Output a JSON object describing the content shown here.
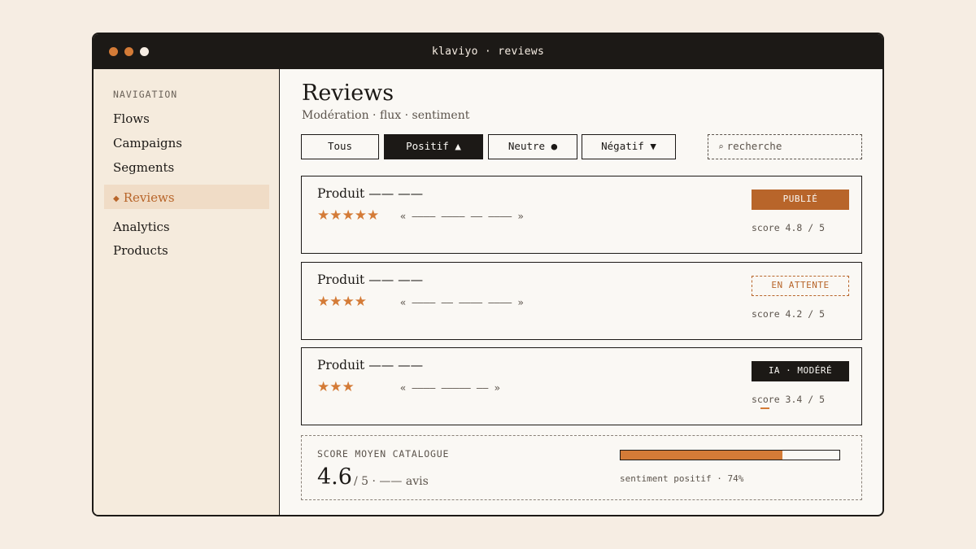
{
  "window": {
    "title": "klaviyo · reviews"
  },
  "sidebar": {
    "heading": "NAVIGATION",
    "items": [
      {
        "label": "Flows",
        "active": false
      },
      {
        "label": "Campaigns",
        "active": false
      },
      {
        "label": "Segments",
        "active": false
      },
      {
        "label": "Reviews",
        "active": true,
        "marker": "◆"
      },
      {
        "label": "Analytics",
        "active": false
      },
      {
        "label": "Products",
        "active": false
      }
    ]
  },
  "header": {
    "title": "Reviews",
    "subtitle": "Modération · flux · sentiment"
  },
  "filters": [
    {
      "label": "Tous",
      "active": false
    },
    {
      "label": "Positif ▲",
      "active": true
    },
    {
      "label": "Neutre ●",
      "active": false
    },
    {
      "label": "Négatif ▼",
      "active": false
    }
  ],
  "search": {
    "icon": "⌕",
    "placeholder": "recherche"
  },
  "reviews": [
    {
      "title": "Produit —— ——",
      "stars": "★★★★★",
      "rating": 5,
      "quote": "« ———— ———— —— ———— »",
      "status": "PUBLIÉ",
      "score": "score 4.8 / 5"
    },
    {
      "title": "Produit —— ——",
      "stars": "★★★★",
      "rating": 4,
      "quote": "« ———— —— ———— ———— »",
      "status": "EN ATTENTE",
      "score": "score 4.2 / 5"
    },
    {
      "title": "Produit —— ——",
      "stars": "★★★",
      "rating": 3,
      "quote": "« ———— ————— —— »",
      "status": "IA · MODÉRÉ",
      "score": "score 3.4 / 5"
    }
  ],
  "summary": {
    "label": "SCORE MOYEN CATALOGUE",
    "value": "4.6",
    "suffix": "/ 5 · —— avis",
    "sentiment_label": "sentiment positif · 74%",
    "sentiment_fraction": 0.74
  },
  "colors": {
    "accent": "#d47b37",
    "accent_dark": "#b8652a",
    "ink": "#1c1916",
    "paper": "#faf8f4",
    "sidebar": "#f5ebdd"
  }
}
